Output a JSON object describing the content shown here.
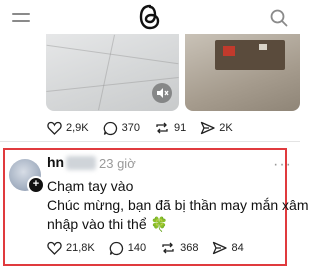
{
  "app": {
    "icons": {
      "menu": "menu-icon",
      "logo": "threads-logo-icon",
      "search": "search-icon"
    }
  },
  "previous_post": {
    "media": [
      "floor-tiles-photo",
      "device-repair-photo"
    ],
    "stats": {
      "likes": "2,9K",
      "replies": "370",
      "reposts": "91",
      "shares": "2K"
    }
  },
  "post": {
    "username": "hn",
    "time": "23 giờ",
    "text_lines": [
      "Chạm tay vào",
      "Chúc mừng, bạn đã bị thần may mắn xâm",
      "nhập vào thi thể 🍀"
    ],
    "stats": {
      "likes": "21,8K",
      "replies": "140",
      "reposts": "368",
      "shares": "84"
    }
  },
  "colors": {
    "highlight": "#e03a3e",
    "muted": "#9a9a9a",
    "text": "#111111"
  }
}
